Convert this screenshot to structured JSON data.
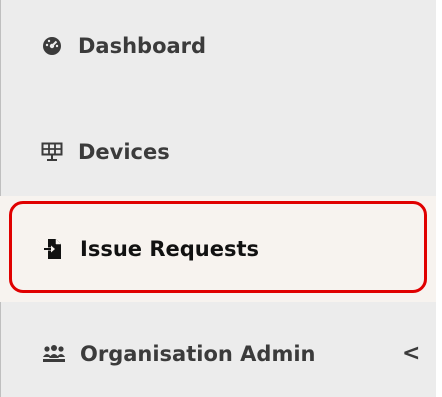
{
  "sidebar": {
    "items": [
      {
        "label": "Dashboard",
        "icon": "dashboard-gauge-icon"
      },
      {
        "label": "Devices",
        "icon": "devices-solar-panel-icon"
      },
      {
        "label": "Issue Requests",
        "icon": "file-export-icon",
        "active": true
      },
      {
        "label": "Organisation Admin",
        "icon": "users-group-icon",
        "expandable": true
      }
    ],
    "expand_indicator": "<"
  },
  "colors": {
    "active_accent": "#2aa5d8",
    "highlight_border": "#e00000",
    "text": "#3b3b3b",
    "sidebar_bg": "#ececec"
  }
}
